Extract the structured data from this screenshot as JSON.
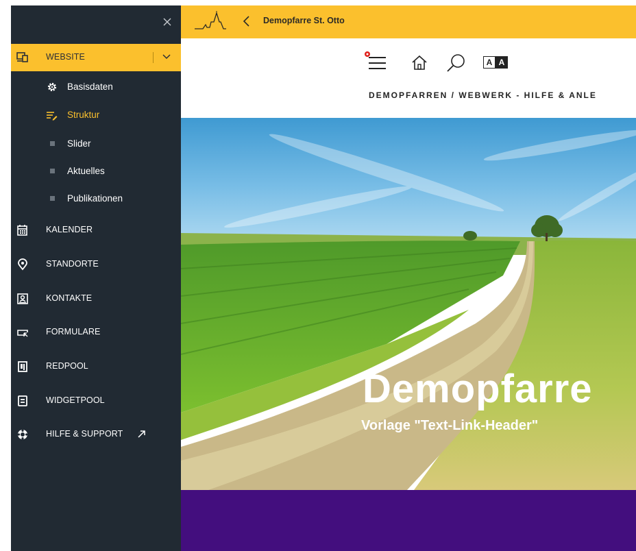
{
  "sidebar": {
    "close_icon": "close-icon",
    "items": [
      {
        "key": "website",
        "label": "WEBSITE",
        "icon": "website-device-icon",
        "active": true
      },
      {
        "key": "kalender",
        "label": "KALENDER",
        "icon": "calendar-icon"
      },
      {
        "key": "standorte",
        "label": "STANDORTE",
        "icon": "location-pin-icon"
      },
      {
        "key": "kontakte",
        "label": "KONTAKTE",
        "icon": "contact-card-icon"
      },
      {
        "key": "formulare",
        "label": "FORMULARE",
        "icon": "form-icon"
      },
      {
        "key": "redpool",
        "label": "REDPOOL",
        "icon": "redpool-icon"
      },
      {
        "key": "widgetpool",
        "label": "WIDGETPOOL",
        "icon": "widget-icon"
      },
      {
        "key": "hilfe",
        "label": "HILFE & SUPPORT",
        "icon": "lifebuoy-icon",
        "external_icon": "external-link-icon"
      }
    ],
    "website_subitems": [
      {
        "label": "Basisdaten",
        "icon": "gear-icon"
      },
      {
        "label": "Struktur",
        "icon": "structure-edit-icon"
      },
      {
        "label": "Slider",
        "icon": "bullet-square-icon"
      },
      {
        "label": "Aktuelles",
        "icon": "bullet-square-icon"
      },
      {
        "label": "Publikationen",
        "icon": "bullet-square-icon"
      }
    ]
  },
  "topbar": {
    "site_name": "Demopfarre St. Otto",
    "logo_icon": "church-logo-icon",
    "back_icon": "chevron-left-icon"
  },
  "page": {
    "toolbar": {
      "menu_icon": "hamburger-menu-icon",
      "home_icon": "home-icon",
      "search_icon": "search-icon",
      "font_size_label_a": "A",
      "font_size_label_b": "A"
    },
    "breadcrumb": "DEMOPFARREN / WEBWERK - HILFE & ANLE",
    "hero": {
      "title": "Demopfarre",
      "subtitle": "Vorlage \"Text-Link-Header\""
    }
  },
  "colors": {
    "accent": "#fbc02d",
    "sidebar_bg": "#212a33",
    "footer_band": "#430e7e",
    "menu_badge": "#e0201b"
  }
}
